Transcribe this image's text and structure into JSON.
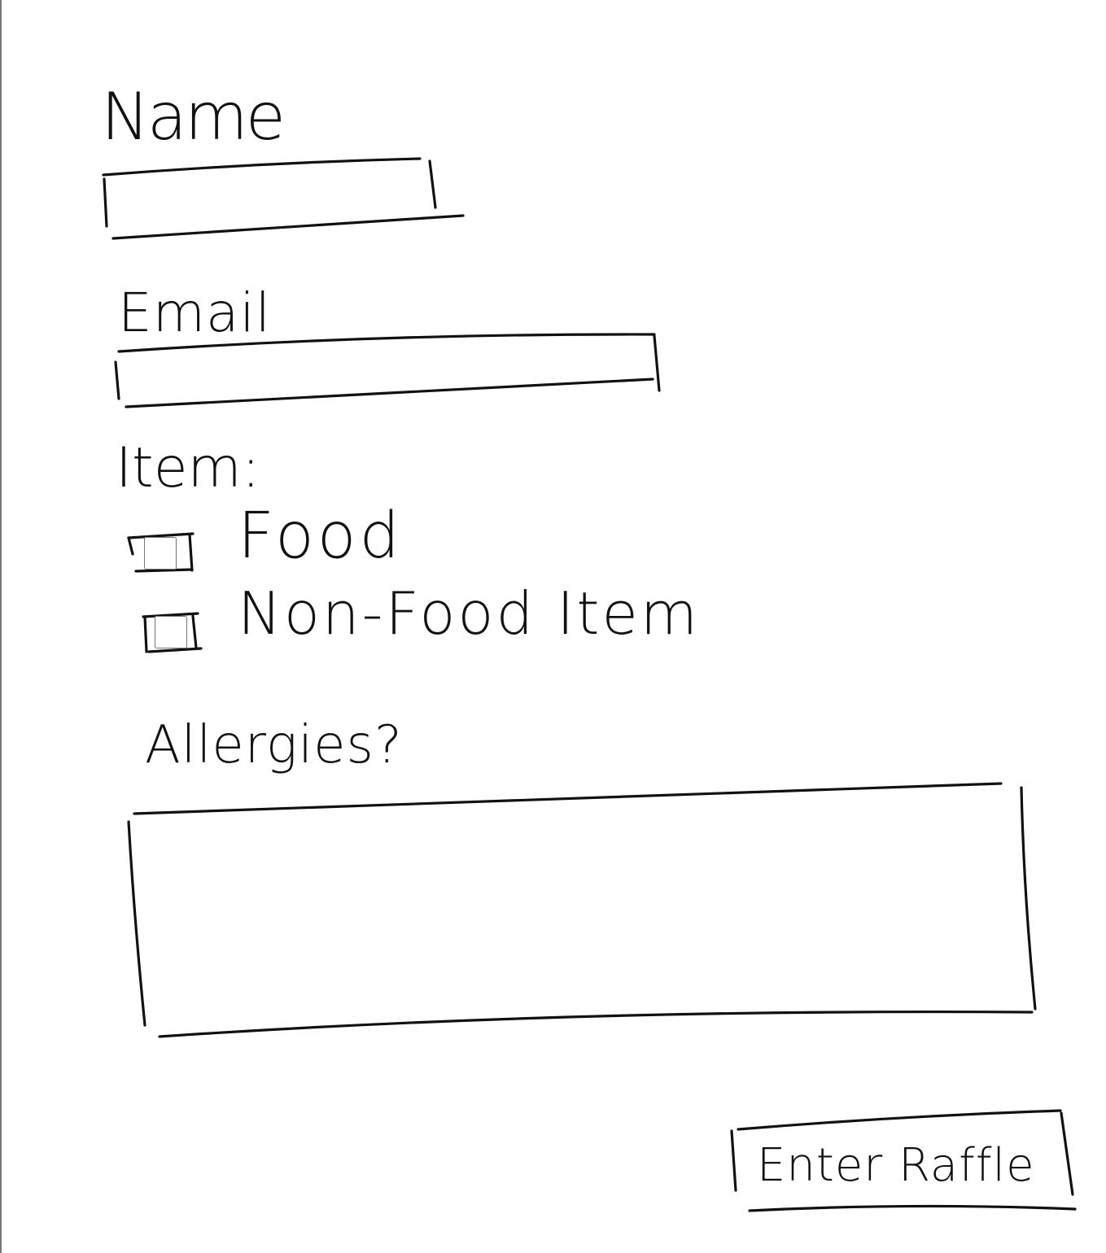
{
  "form": {
    "name_label": "Name",
    "name_value": "",
    "email_label": "Email",
    "email_value": "",
    "item_label": "Item:",
    "options": [
      {
        "label": "Food",
        "checked": false
      },
      {
        "label": "Non-Food Item",
        "checked": false
      }
    ],
    "allergies_label": "Allergies?",
    "allergies_value": "",
    "submit_label": "Enter Raffle"
  }
}
